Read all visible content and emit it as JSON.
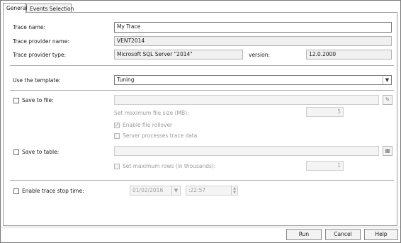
{
  "tabs": [
    {
      "label": "General"
    },
    {
      "label": "Events Selection"
    }
  ],
  "general": {
    "trace_name_label": "Trace name:",
    "trace_name_value": "My Trace",
    "trace_provider_name_label": "Trace provider name:",
    "trace_provider_name_value": "VENT2014",
    "trace_provider_type_label": "Trace provider type:",
    "trace_provider_type_value": "Microsoft SQL Server \"2014\"",
    "version_label": "version:",
    "version_value": "12.0.2000",
    "template_label": "Use the template:",
    "template_value": "Tuning",
    "save_to_file_label": "Save to file:",
    "save_to_file_value": "",
    "max_file_size_label": "Set maximum file size (MB):",
    "max_file_size_value": "5",
    "enable_rollover_label": "Enable file rollover",
    "server_process_label": "Server processes trace data",
    "save_to_table_label": "Save to table:",
    "save_to_table_value": "",
    "max_rows_label": "Set maximum rows (in thousands):",
    "max_rows_value": "1",
    "enable_stop_time_label": "Enable trace stop time:",
    "stop_date_value": "01/02/2016",
    "stop_time_value": "  :22:57"
  },
  "footer": {
    "run_label": "Run",
    "cancel_label": "Cancel",
    "help_label": "Help"
  },
  "icons": {
    "browse_file": "folder-icon",
    "browse_table": "table-icon",
    "dropdown": "chevron-down-icon"
  }
}
